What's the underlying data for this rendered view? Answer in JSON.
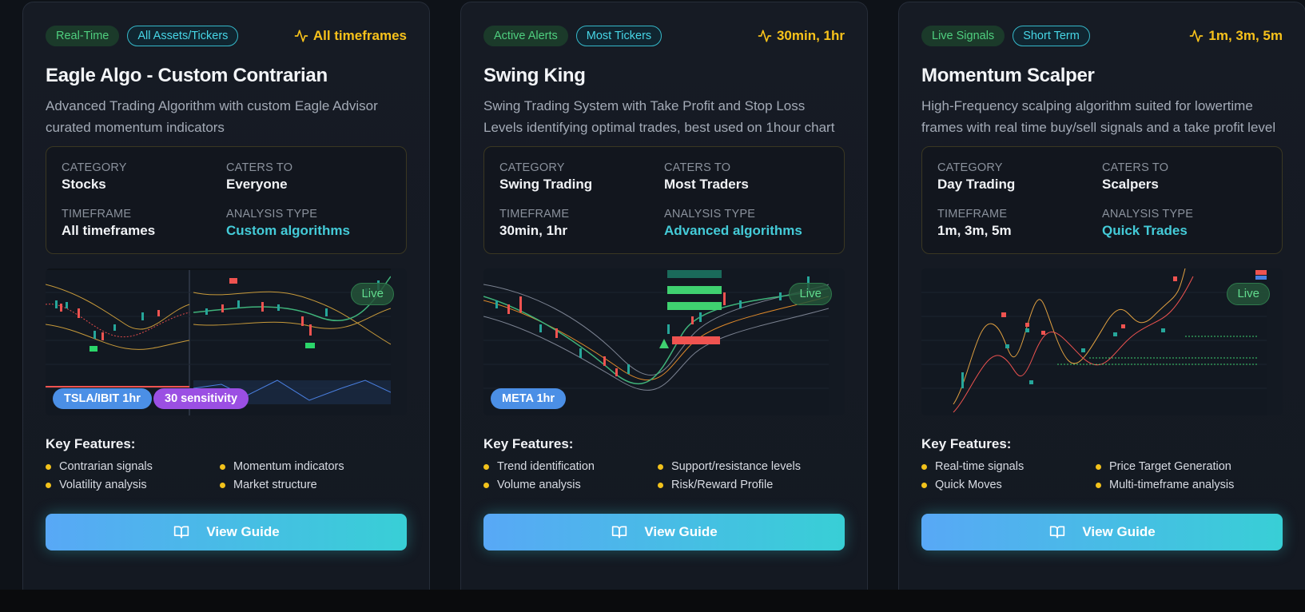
{
  "cards": [
    {
      "badges": [
        "Real-Time",
        "All Assets/Tickers"
      ],
      "timeframe_badge": "All timeframes",
      "title": "Eagle Algo - Custom Contrarian",
      "description": "Advanced Trading Algorithm with custom Eagle Advisor curated momentum indicators",
      "info": {
        "category_label": "CATEGORY",
        "category": "Stocks",
        "caters_label": "CATERS TO",
        "caters": "Everyone",
        "timeframe_label": "TIMEFRAME",
        "timeframe": "All timeframes",
        "analysis_label": "ANALYSIS TYPE",
        "analysis": "Custom algorithms"
      },
      "live": "Live",
      "chart_pills": [
        "TSLA/IBIT 1hr",
        "30 sensitivity"
      ],
      "features_title": "Key Features:",
      "features": [
        "Contrarian signals",
        "Momentum indicators",
        "Volatility analysis",
        "Market structure"
      ],
      "button": "View Guide"
    },
    {
      "badges": [
        "Active Alerts",
        "Most Tickers"
      ],
      "timeframe_badge": "30min, 1hr",
      "title": "Swing King",
      "description": "Swing Trading System with Take Profit and Stop Loss Levels identifying optimal trades, best used on 1hour chart",
      "info": {
        "category_label": "CATEGORY",
        "category": "Swing Trading",
        "caters_label": "CATERS TO",
        "caters": "Most Traders",
        "timeframe_label": "TIMEFRAME",
        "timeframe": "30min, 1hr",
        "analysis_label": "ANALYSIS TYPE",
        "analysis": "Advanced algorithms"
      },
      "live": "Live",
      "chart_pills": [
        "META 1hr"
      ],
      "features_title": "Key Features:",
      "features": [
        "Trend identification",
        "Support/resistance levels",
        "Volume analysis",
        "Risk/Reward Profile"
      ],
      "button": "View Guide"
    },
    {
      "badges": [
        "Live Signals",
        "Short Term"
      ],
      "timeframe_badge": "1m, 3m, 5m",
      "title": "Momentum Scalper",
      "description": "High-Frequency scalping algorithm suited for lowertime frames with real time buy/sell signals and a take profit level",
      "info": {
        "category_label": "CATEGORY",
        "category": "Day Trading",
        "caters_label": "CATERS TO",
        "caters": "Scalpers",
        "timeframe_label": "TIMEFRAME",
        "timeframe": "1m, 3m, 5m",
        "analysis_label": "ANALYSIS TYPE",
        "analysis": "Quick Trades"
      },
      "live": "Live",
      "chart_pills": [],
      "features_title": "Key Features:",
      "features": [
        "Real-time signals",
        "Price Target Generation",
        "Quick Moves",
        "Multi-timeframe analysis"
      ],
      "button": "View Guide"
    }
  ],
  "icons": {
    "timeframe": "activity-icon",
    "guide": "book-open-icon"
  },
  "colors": {
    "accent_cyan": "#44cbd8",
    "accent_yellow": "#f7c21b",
    "live_green": "#62dc8e",
    "pill_blue": "#4b8fe6",
    "pill_purple": "#9b4fe3"
  }
}
